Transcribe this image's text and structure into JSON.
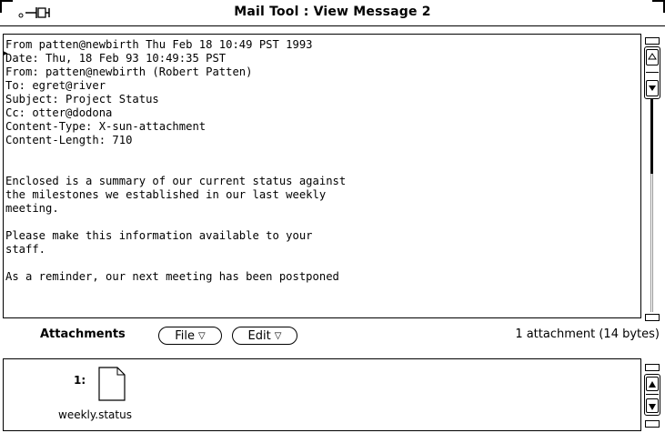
{
  "window": {
    "title": "Mail Tool : View Message 2"
  },
  "message": {
    "lines": [
      "From patten@newbirth Thu Feb 18 10:49 PST 1993",
      "Date: Thu, 18 Feb 93 10:49:35 PST",
      "From: patten@newbirth (Robert Patten)",
      "To: egret@river",
      "Subject: Project Status",
      "Cc: otter@dodona",
      "Content-Type: X-sun-attachment",
      "Content-Length: 710",
      "",
      "",
      "Enclosed is a summary of our current status against",
      "the milestones we established in our last weekly",
      "meeting.",
      "",
      "Please make this information available to your",
      "staff.",
      "",
      "As a reminder, our next meeting has been postponed"
    ]
  },
  "attachments": {
    "label": "Attachments",
    "file_button": "File",
    "edit_button": "Edit",
    "count_text": "1 attachment (14 bytes)",
    "items": [
      {
        "number": "1:",
        "name": "weekly.status",
        "icon": "document-icon"
      }
    ]
  }
}
